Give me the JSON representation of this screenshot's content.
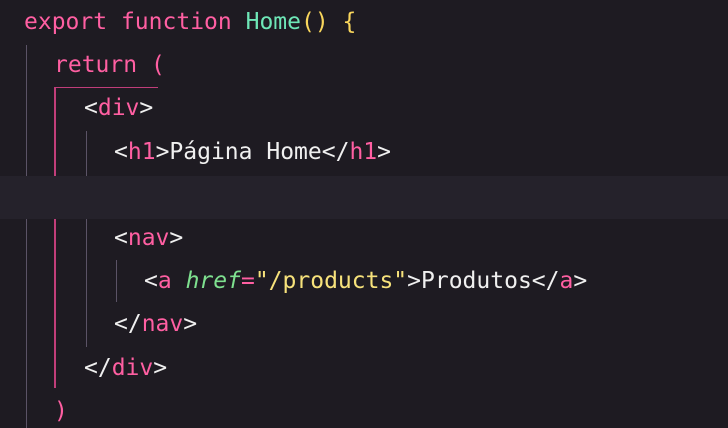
{
  "code": {
    "l1": {
      "kw": "export",
      "kw2": "function",
      "fn": "Home",
      "parens": "()",
      "brace": "{"
    },
    "l2": {
      "kw": "return",
      "paren": "("
    },
    "l3": {
      "open": "<",
      "tag": "div",
      "close": ">"
    },
    "l4": {
      "open": "<",
      "tag": "h1",
      "close": ">",
      "text": "Página Home",
      "endopen": "</",
      "endtag": "h1",
      "endclose": ">"
    },
    "l6": {
      "open": "<",
      "tag": "nav",
      "close": ">"
    },
    "l7": {
      "open": "<",
      "tag": "a",
      "attr": "href",
      "eq": "=",
      "value": "\"/products\"",
      "close": ">",
      "text": "Produtos",
      "endopen": "</",
      "endtag": "a",
      "endclose": ">"
    },
    "l8": {
      "open": "</",
      "tag": "nav",
      "close": ">"
    },
    "l9": {
      "open": "</",
      "tag": "div",
      "close": ">"
    },
    "l10": {
      "paren": ")"
    }
  },
  "colors": {
    "background": "#1e1b22",
    "keyword": "#ff5fa2",
    "function": "#6ee7b7",
    "string": "#f7e27b",
    "attribute": "#7ee08f"
  }
}
